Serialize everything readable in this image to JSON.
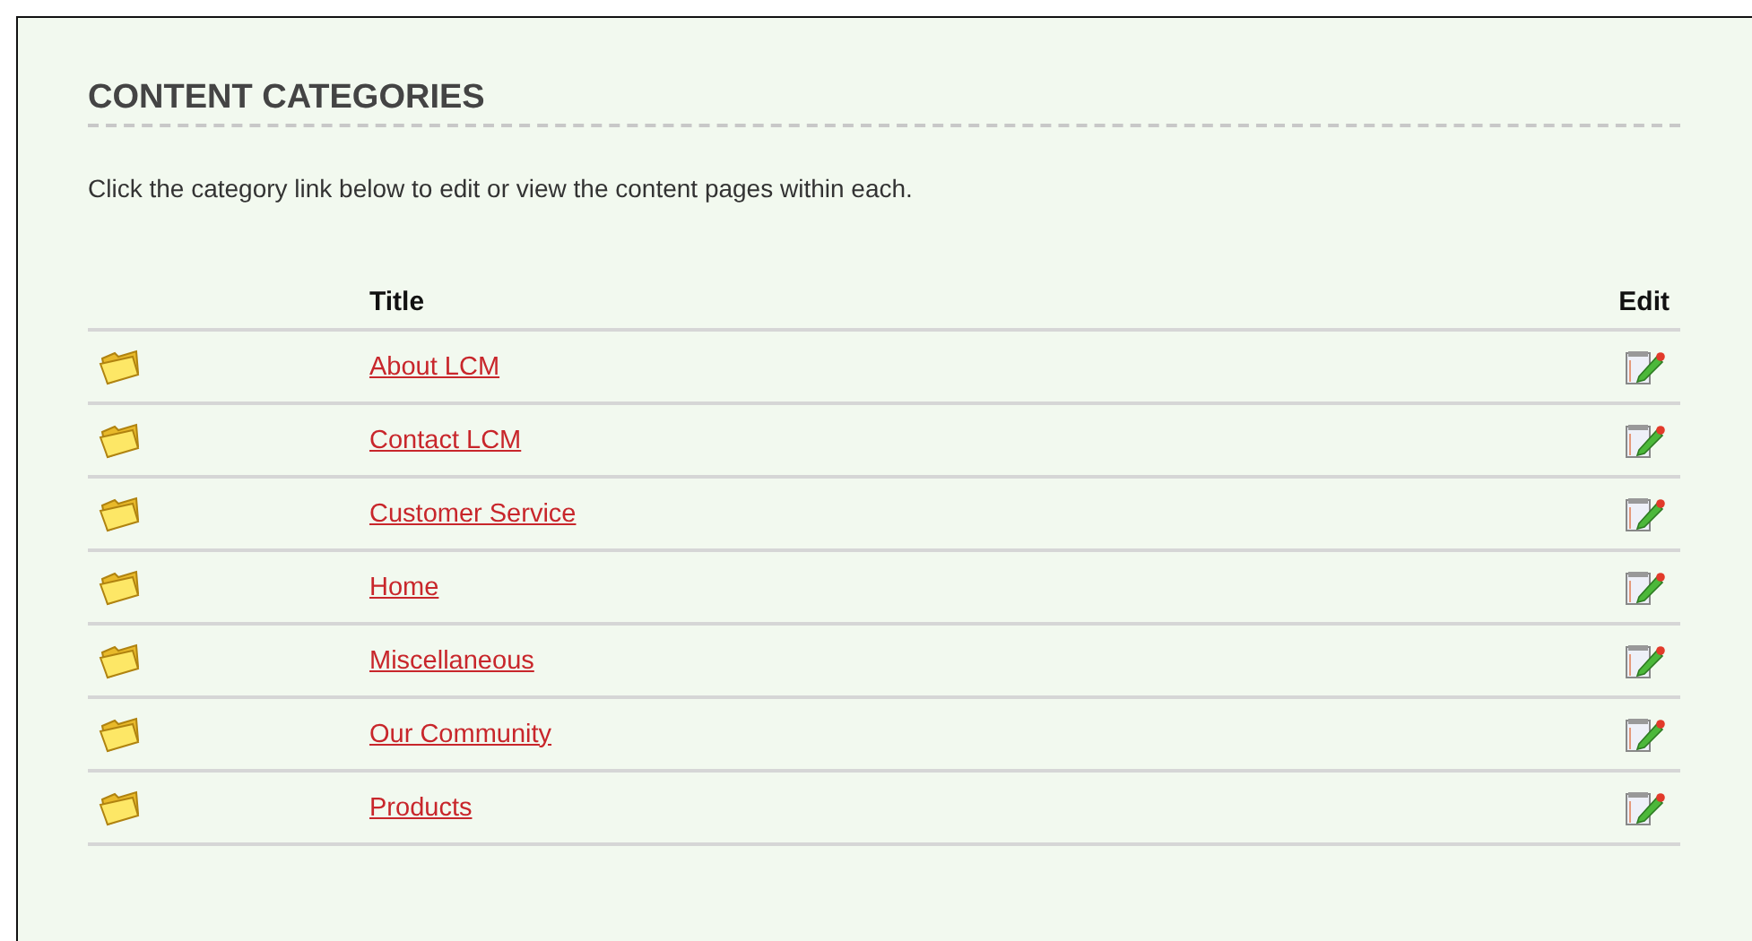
{
  "heading": "CONTENT CATEGORIES",
  "intro": "Click the category link below to edit or view the content pages within each.",
  "table": {
    "columns": [
      "Title",
      "Edit"
    ],
    "rows": [
      {
        "title": "About LCM"
      },
      {
        "title": "Contact LCM"
      },
      {
        "title": "Customer Service"
      },
      {
        "title": "Home"
      },
      {
        "title": "Miscellaneous"
      },
      {
        "title": "Our Community"
      },
      {
        "title": "Products"
      }
    ]
  }
}
